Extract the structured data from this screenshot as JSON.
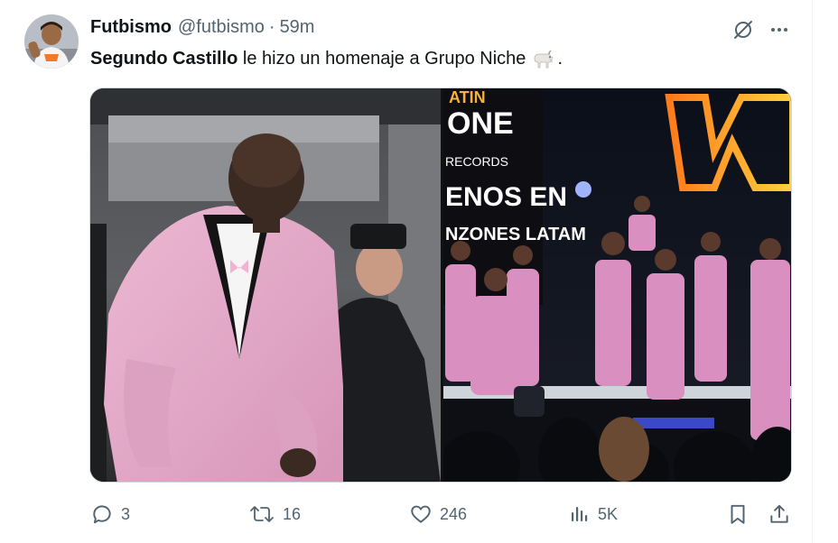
{
  "tweet": {
    "author_name": "Futbismo",
    "author_handle": "@futbismo",
    "separator": "·",
    "time": "59m",
    "text_bold": "Segundo Castillo",
    "text_rest": "le hizo un homenaje a Grupo Niche",
    "text_end": ".",
    "emoji_icon": "goat-icon"
  },
  "media": {
    "right_banner_lines": [
      "ATIN",
      "ONE",
      "RECORDS",
      "ENOS EN",
      "NZONES LATAM"
    ]
  },
  "actions": {
    "replies": "3",
    "reposts": "16",
    "likes": "246",
    "views": "5K"
  },
  "colors": {
    "text": "#0f1419",
    "secondary": "#536471",
    "suit_pink": "#e2a6c7",
    "border": "#cfd9de"
  }
}
